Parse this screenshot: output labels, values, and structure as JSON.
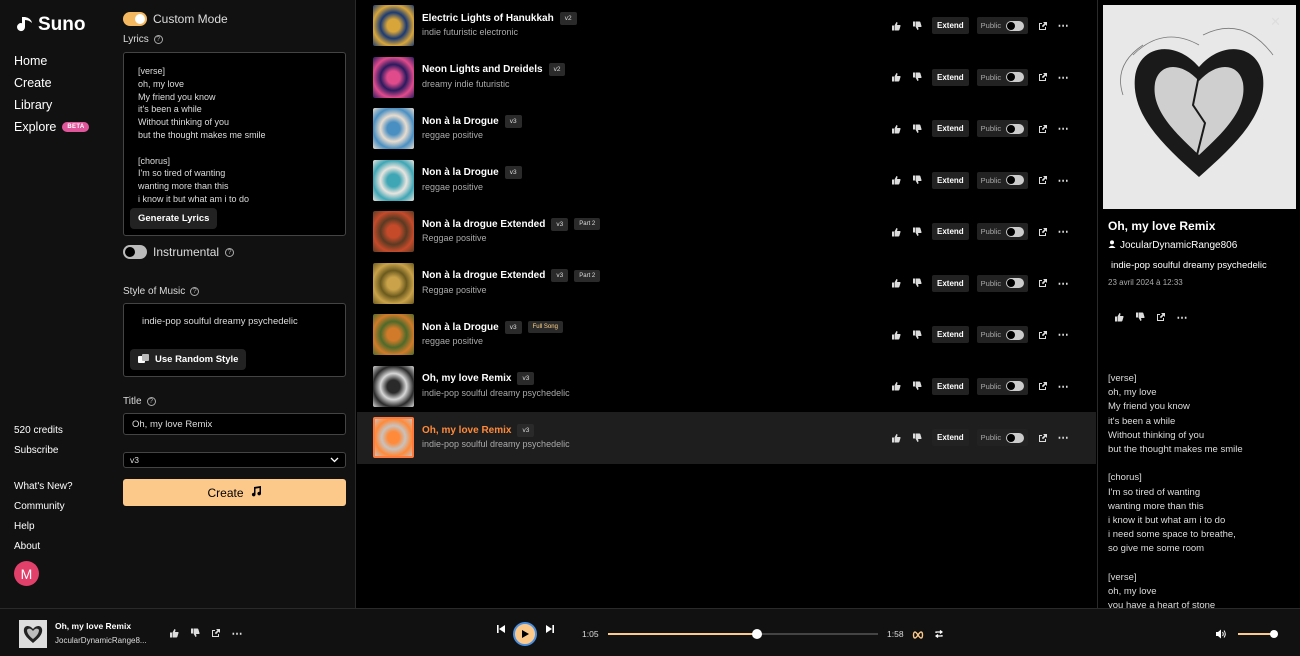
{
  "brand": {
    "name": "Suno"
  },
  "nav": {
    "items": [
      {
        "label": "Home"
      },
      {
        "label": "Create"
      },
      {
        "label": "Library"
      },
      {
        "label": "Explore",
        "badge": "BETA"
      }
    ],
    "credits": "520 credits",
    "subscribe": "Subscribe",
    "links": [
      "What's New?",
      "Community",
      "Help",
      "About"
    ],
    "avatar_letter": "M"
  },
  "create": {
    "custom_mode_label": "Custom Mode",
    "custom_mode_on": true,
    "lyrics_label": "Lyrics",
    "lyrics_text": "[verse]\noh, my love\nMy friend you know\nit's been a while\nWithout thinking of you\nbut the thought makes me smile\n\n[chorus]\nI'm so tired of wanting\nwanting more than this\ni know it but what am i to do",
    "generate_lyrics_label": "Generate Lyrics",
    "instrumental_label": "Instrumental",
    "instrumental_on": false,
    "style_label": "Style of Music",
    "style_value": "indie-pop soulful  dreamy psychedelic",
    "random_style_label": "Use Random Style",
    "title_label": "Title",
    "title_value": "Oh, my love Remix",
    "model_value": "v3",
    "create_label": "Create"
  },
  "songs": [
    {
      "title": "Electric Lights of Hanukkah",
      "version": "v2",
      "tag": "",
      "genre": "indie futuristic electronic"
    },
    {
      "title": "Neon Lights and Dreidels",
      "version": "v2",
      "tag": "",
      "genre": "dreamy indie futuristic"
    },
    {
      "title": "Non à la Drogue",
      "version": "v3",
      "tag": "",
      "genre": "reggae positive"
    },
    {
      "title": "Non à la Drogue",
      "version": "v3",
      "tag": "",
      "genre": "reggae positive"
    },
    {
      "title": "Non à la drogue Extended",
      "version": "v3",
      "tag": "Part 2",
      "genre": "Reggae positive"
    },
    {
      "title": "Non à la drogue Extended",
      "version": "v3",
      "tag": "Part 2",
      "genre": "Reggae positive"
    },
    {
      "title": "Non à la Drogue",
      "version": "v3",
      "tag": "Full Song",
      "genre": "reggae positive"
    },
    {
      "title": "Oh, my love Remix",
      "version": "v3",
      "tag": "",
      "genre": "indie-pop soulful dreamy psychedelic"
    },
    {
      "title": "Oh, my love Remix",
      "version": "v3",
      "tag": "",
      "genre": "indie-pop soulful dreamy psychedelic",
      "selected": true
    }
  ],
  "row_actions": {
    "extend_label": "Extend",
    "public_label": "Public"
  },
  "detail": {
    "title": "Oh, my love Remix",
    "user": "JocularDynamicRange806",
    "style": "indie-pop soulful  dreamy psychedelic",
    "date": "23 avril 2024 à 12:33",
    "lyrics": "[verse]\noh, my love\nMy friend you know\nit's been a while\nWithout thinking of you\nbut the thought makes me smile\n\n[chorus]\nI'm so tired of wanting\nwanting more than this\ni know it but what am i to do\ni need some space to breathe,\nso give me some room\n\n[verse]\noh, my love\nyou have a heart of stone"
  },
  "player": {
    "title": "Oh, my love Remix",
    "user": "JocularDynamicRange8...",
    "elapsed": "1:05",
    "duration": "1:58",
    "progress_fraction": 0.55,
    "volume_fraction": 1.0
  },
  "colors": {
    "accent": "#fdc98a",
    "selected_title": "#ff8a3a",
    "beta": "#e0569b",
    "avatar": "#e0406a"
  }
}
